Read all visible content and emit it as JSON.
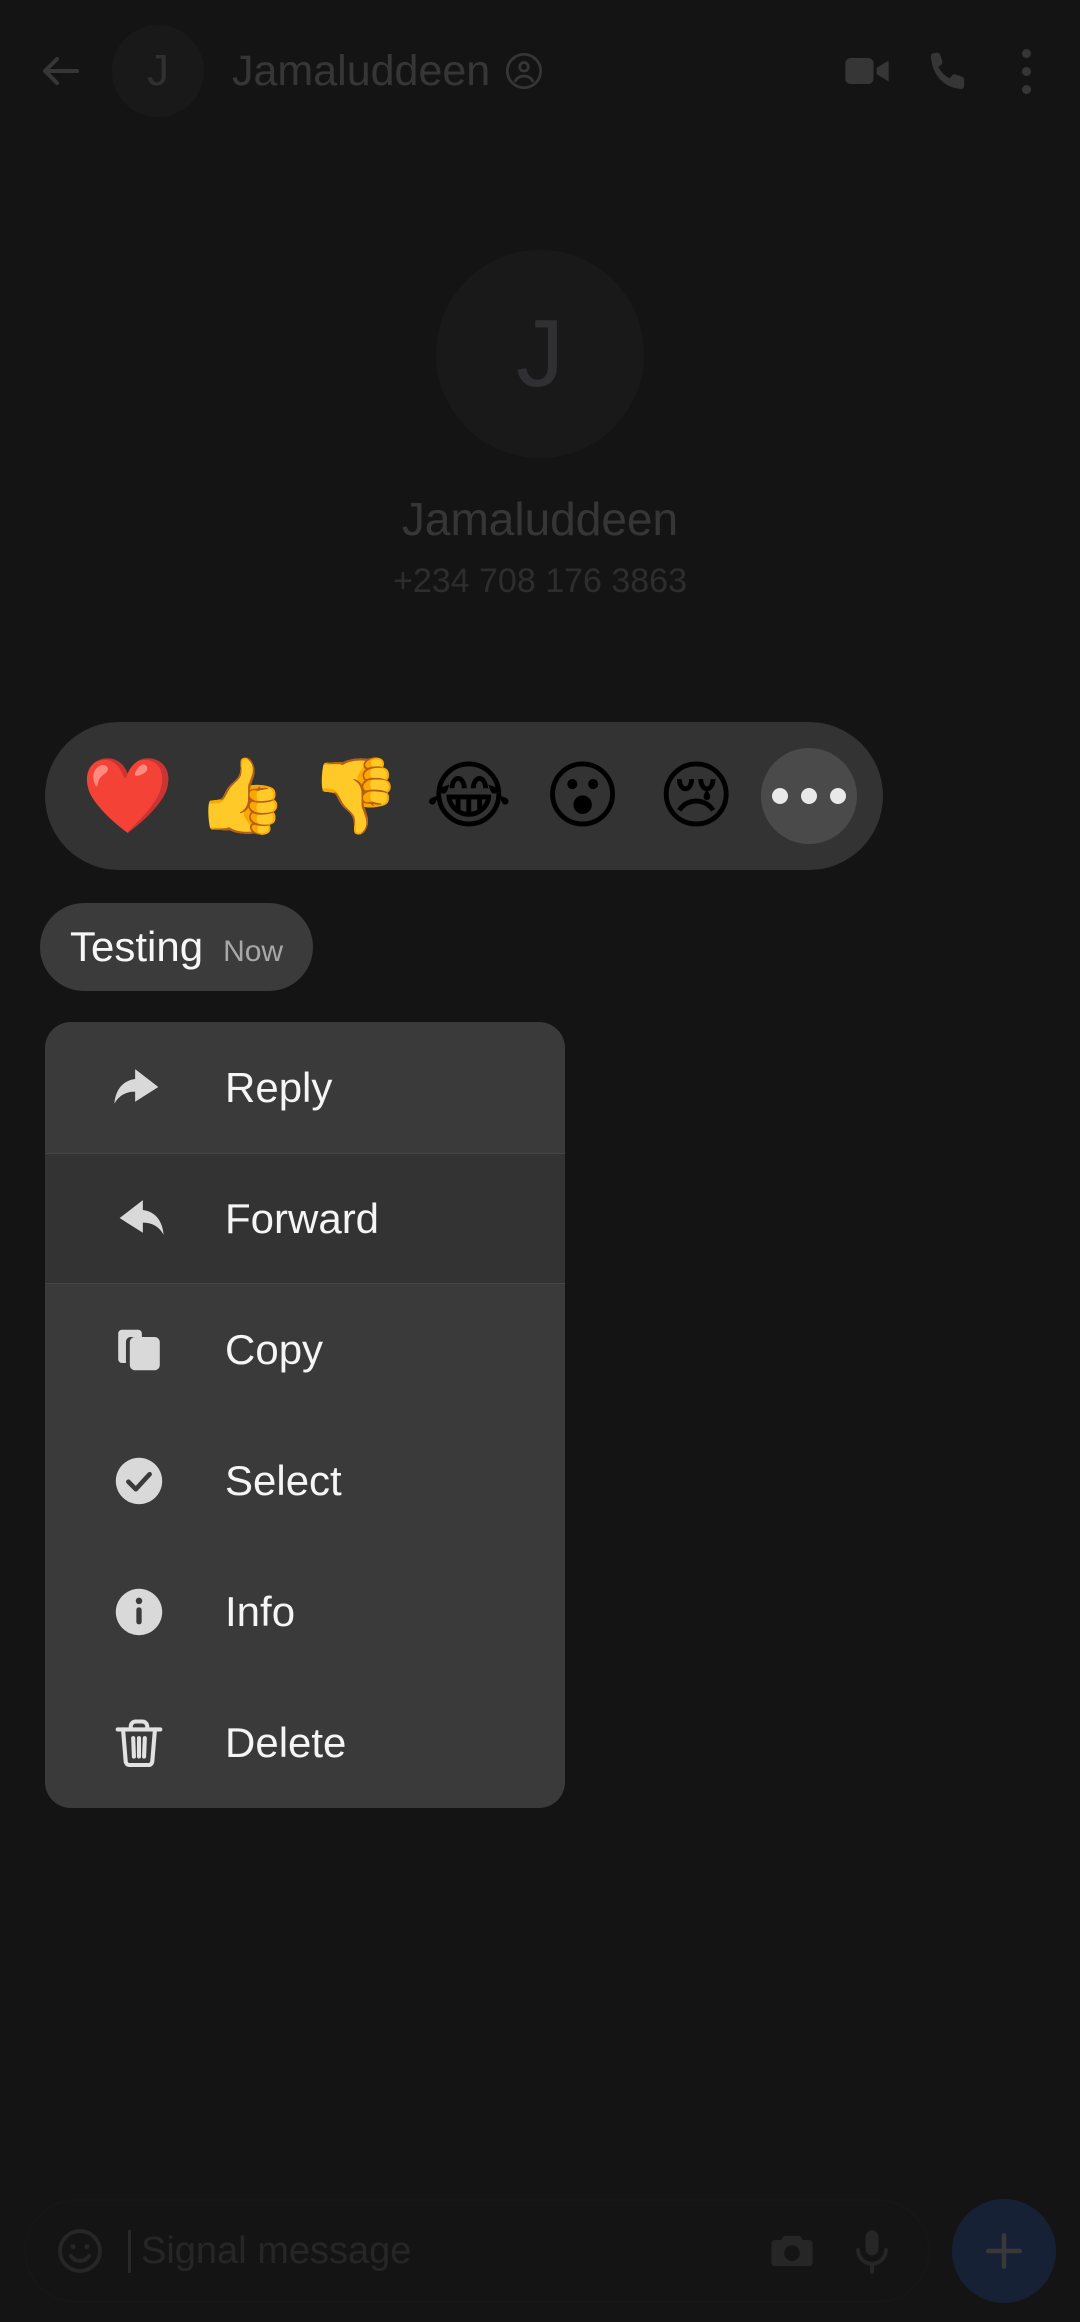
{
  "header": {
    "back_icon": "back-arrow-icon",
    "avatar_initial": "J",
    "contact_name": "Jamaluddeen",
    "verified_icon": "contact-profile-icon",
    "video_icon": "video-call-icon",
    "call_icon": "phone-call-icon",
    "overflow_icon": "more-options-icon"
  },
  "conversation_intro": {
    "avatar_initial": "J",
    "name": "Jamaluddeen",
    "phone": "+234 708 176 3863"
  },
  "reaction_bar": {
    "reactions": [
      {
        "name": "heart-reaction",
        "glyph": "❤️"
      },
      {
        "name": "thumbs-up-reaction",
        "glyph": "👍"
      },
      {
        "name": "thumbs-down-reaction",
        "glyph": "👎"
      },
      {
        "name": "joy-reaction",
        "glyph": "😂"
      },
      {
        "name": "open-mouth-reaction",
        "glyph": "😮"
      },
      {
        "name": "crying-reaction",
        "glyph": "😢"
      }
    ],
    "more_label": "more-reactions"
  },
  "focused_message": {
    "text": "Testing",
    "timestamp": "Now"
  },
  "context_menu": {
    "items": [
      {
        "label": "Reply",
        "icon": "reply-icon",
        "active": false
      },
      {
        "label": "Forward",
        "icon": "forward-icon",
        "active": true
      },
      {
        "label": "Copy",
        "icon": "copy-icon",
        "active": false
      },
      {
        "label": "Select",
        "icon": "select-icon",
        "active": false
      },
      {
        "label": "Info",
        "icon": "info-icon",
        "active": false
      },
      {
        "label": "Delete",
        "icon": "delete-icon",
        "active": false
      }
    ]
  },
  "compose": {
    "emoji_icon": "emoji-picker-icon",
    "placeholder": "Signal message",
    "camera_icon": "camera-icon",
    "mic_icon": "microphone-icon",
    "add_icon": "add-attachment-icon"
  },
  "colors": {
    "background": "#141414",
    "surface": "#3a3a3a",
    "bubble": "#3b3b3b",
    "accent": "#2c6bed",
    "text_primary": "#f5f5f5",
    "text_secondary": "#a8a8a8"
  }
}
